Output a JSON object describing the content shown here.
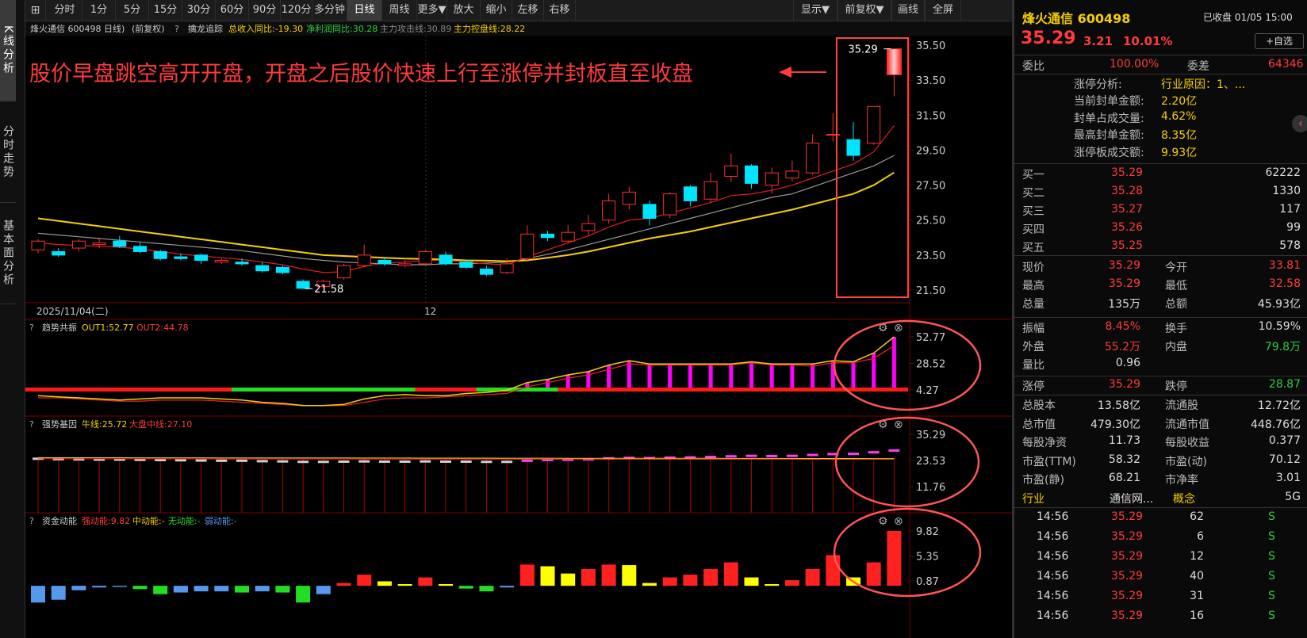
{
  "left_tabs": [
    "K线分析",
    "分时走势",
    "基本面分析"
  ],
  "toolbar": {
    "left": [
      "分时",
      "1分",
      "5分",
      "15分",
      "30分",
      "60分",
      "90分",
      "120分",
      "多分钟",
      "日线",
      "周线",
      "更多▼",
      "放大",
      "缩小",
      "左移",
      "右移"
    ],
    "active": "日线",
    "right": [
      "显示▼",
      "前复权▼",
      "画线",
      "全屏"
    ]
  },
  "main": {
    "header_name": "烽火通信 600498 日线)",
    "header_adj": "(前复权)",
    "indicator_name": "擒龙追踪",
    "indicator_values": [
      {
        "text": "总收入同比:-19.30",
        "color": "#f5d000"
      },
      {
        "text": "净利润同比:30.28",
        "color": "#2ecc40"
      },
      {
        "text": "主力攻击线:30.89",
        "color": "#888888"
      },
      {
        "text": "主力控盘线:28.22",
        "color": "#f5d000"
      }
    ],
    "y_labels": [
      "35.50",
      "33.50",
      "31.50",
      "29.50",
      "27.50",
      "25.50",
      "23.50",
      "21.50"
    ],
    "y_values": [
      35.5,
      33.5,
      31.5,
      29.5,
      27.5,
      25.5,
      23.5,
      21.5
    ],
    "annotation": "股价早盘跳空高开开盘，开盘之后股价快速上行至涨停并封板直至收盘",
    "high_label": "35.29",
    "low_label": "21.58",
    "date_label": "2025/11/04(二)",
    "month_label": "12",
    "candles": [
      {
        "o": 23.8,
        "c": 24.3,
        "h": 24.4,
        "l": 23.6
      },
      {
        "o": 23.7,
        "c": 23.5,
        "h": 23.9,
        "l": 23.4
      },
      {
        "o": 23.9,
        "c": 24.3,
        "h": 24.4,
        "l": 23.7
      },
      {
        "o": 24.1,
        "c": 24.2,
        "h": 24.5,
        "l": 23.9
      },
      {
        "o": 24.3,
        "c": 24.0,
        "h": 24.6,
        "l": 23.9
      },
      {
        "o": 24.0,
        "c": 23.7,
        "h": 24.2,
        "l": 23.6
      },
      {
        "o": 23.7,
        "c": 23.3,
        "h": 23.8,
        "l": 23.2
      },
      {
        "o": 23.4,
        "c": 23.3,
        "h": 23.6,
        "l": 23.2
      },
      {
        "o": 23.5,
        "c": 23.2,
        "h": 23.6,
        "l": 23.0
      },
      {
        "o": 23.1,
        "c": 23.2,
        "h": 23.3,
        "l": 23.0
      },
      {
        "o": 23.1,
        "c": 23.0,
        "h": 23.3,
        "l": 22.9
      },
      {
        "o": 22.9,
        "c": 22.6,
        "h": 23.1,
        "l": 22.5
      },
      {
        "o": 22.8,
        "c": 22.5,
        "h": 22.9,
        "l": 22.4
      },
      {
        "o": 22.0,
        "c": 21.6,
        "h": 22.1,
        "l": 21.58
      },
      {
        "o": 21.7,
        "c": 22.0,
        "h": 22.1,
        "l": 21.6
      },
      {
        "o": 22.2,
        "c": 22.9,
        "h": 23.0,
        "l": 22.1
      },
      {
        "o": 22.9,
        "c": 23.5,
        "h": 24.1,
        "l": 22.8
      },
      {
        "o": 23.2,
        "c": 23.0,
        "h": 23.4,
        "l": 22.9
      },
      {
        "o": 22.9,
        "c": 23.0,
        "h": 23.2,
        "l": 22.8
      },
      {
        "o": 23.0,
        "c": 23.7,
        "h": 23.8,
        "l": 22.9
      },
      {
        "o": 23.5,
        "c": 23.0,
        "h": 23.7,
        "l": 22.9
      },
      {
        "o": 23.1,
        "c": 22.8,
        "h": 23.2,
        "l": 22.7
      },
      {
        "o": 22.7,
        "c": 22.4,
        "h": 22.9,
        "l": 22.3
      },
      {
        "o": 22.5,
        "c": 23.0,
        "h": 23.3,
        "l": 22.4
      },
      {
        "o": 23.3,
        "c": 24.7,
        "h": 25.2,
        "l": 23.2
      },
      {
        "o": 24.7,
        "c": 24.5,
        "h": 24.9,
        "l": 24.3
      },
      {
        "o": 24.3,
        "c": 24.8,
        "h": 25.2,
        "l": 24.2
      },
      {
        "o": 24.9,
        "c": 25.3,
        "h": 25.8,
        "l": 24.6
      },
      {
        "o": 25.5,
        "c": 26.6,
        "h": 27.0,
        "l": 25.3
      },
      {
        "o": 26.4,
        "c": 27.1,
        "h": 27.4,
        "l": 26.1
      },
      {
        "o": 26.4,
        "c": 25.6,
        "h": 26.6,
        "l": 25.2
      },
      {
        "o": 25.8,
        "c": 27.0,
        "h": 27.1,
        "l": 25.6
      },
      {
        "o": 27.4,
        "c": 26.6,
        "h": 27.5,
        "l": 26.3
      },
      {
        "o": 26.7,
        "c": 27.7,
        "h": 28.2,
        "l": 26.5
      },
      {
        "o": 28.0,
        "c": 28.6,
        "h": 29.3,
        "l": 27.7
      },
      {
        "o": 28.6,
        "c": 27.6,
        "h": 28.7,
        "l": 27.3
      },
      {
        "o": 27.5,
        "c": 28.2,
        "h": 28.5,
        "l": 27.0
      },
      {
        "o": 27.9,
        "c": 28.3,
        "h": 28.9,
        "l": 27.7
      },
      {
        "o": 28.2,
        "c": 29.9,
        "h": 30.4,
        "l": 28.1
      },
      {
        "o": 30.4,
        "c": 30.4,
        "h": 31.6,
        "l": 30.0
      },
      {
        "o": 30.1,
        "c": 29.2,
        "h": 31.1,
        "l": 28.9
      },
      {
        "o": 29.9,
        "c": 32.0,
        "h": 32.0,
        "l": 29.8
      },
      {
        "o": 33.81,
        "c": 35.29,
        "h": 35.29,
        "l": 32.58
      }
    ],
    "ma_gray": [
      24.75,
      24.65,
      24.55,
      24.45,
      24.35,
      24.25,
      24.15,
      24.05,
      23.95,
      23.85,
      23.75,
      23.6,
      23.45,
      23.3,
      23.2,
      23.1,
      23.05,
      23.0,
      22.95,
      22.95,
      23.0,
      23.0,
      23.05,
      23.1,
      23.3,
      23.55,
      23.8,
      24.1,
      24.4,
      24.7,
      25.0,
      25.3,
      25.6,
      25.9,
      26.2,
      26.5,
      26.8,
      27.0,
      27.4,
      27.8,
      28.2,
      28.6,
      29.2
    ],
    "ma_red": [
      24.2,
      24.1,
      24.05,
      24.0,
      23.95,
      23.85,
      23.7,
      23.55,
      23.45,
      23.35,
      23.25,
      23.1,
      22.95,
      22.7,
      22.5,
      22.55,
      22.85,
      23.05,
      23.1,
      23.2,
      23.2,
      23.1,
      23.0,
      22.95,
      23.4,
      23.8,
      24.2,
      24.6,
      25.1,
      25.5,
      25.6,
      25.9,
      26.2,
      26.5,
      26.9,
      27.0,
      27.2,
      27.5,
      27.9,
      28.3,
      28.7,
      29.4,
      30.9
    ],
    "ma_yellow": [
      25.6,
      25.45,
      25.3,
      25.15,
      25.0,
      24.85,
      24.7,
      24.55,
      24.4,
      24.25,
      24.1,
      23.95,
      23.8,
      23.65,
      23.5,
      23.45,
      23.4,
      23.35,
      23.3,
      23.28,
      23.25,
      23.2,
      23.18,
      23.15,
      23.2,
      23.35,
      23.5,
      23.7,
      23.95,
      24.2,
      24.45,
      24.65,
      24.85,
      25.1,
      25.35,
      25.6,
      25.85,
      26.1,
      26.4,
      26.7,
      27.0,
      27.5,
      28.22
    ]
  },
  "panel2": {
    "title": "趋势共振",
    "v1": "OUT1:52.77",
    "v2": "OUT2:44.78",
    "y_labels": [
      "52.77",
      "28.52",
      "4.27"
    ],
    "y_values": [
      52.77,
      28.52,
      4.27
    ],
    "out1": [
      -1,
      -2,
      -3,
      -4,
      -5,
      -4,
      -3,
      -3,
      -3,
      -4,
      -5,
      -7,
      -8,
      -10,
      -10,
      -9,
      -4,
      -1,
      0,
      -1,
      -1,
      1,
      2,
      4,
      11,
      14,
      18,
      21,
      27,
      31,
      28,
      28,
      28,
      28,
      28,
      30,
      28,
      28,
      28,
      31,
      30,
      38,
      52.77
    ],
    "out2": [
      -3,
      -3,
      -4,
      -5,
      -6,
      -6,
      -5,
      -5,
      -5,
      -6,
      -7,
      -8,
      -9,
      -10,
      -10,
      -10,
      -7,
      -4,
      -3,
      -3,
      -2,
      -1,
      0,
      1,
      7,
      11,
      15,
      18,
      23,
      28,
      27,
      27,
      27,
      27,
      27,
      29,
      27,
      27,
      26,
      29,
      29,
      33,
      44.78
    ],
    "bar_colors": [
      "red",
      "red",
      "red",
      "red",
      "red",
      "red",
      "red",
      "red",
      "red",
      "red",
      "green",
      "green",
      "green",
      "green",
      "green",
      "green",
      "green",
      "green",
      "green",
      "red",
      "red",
      "red",
      "green",
      "green",
      "green",
      "green",
      "red",
      "red",
      "red",
      "red",
      "red",
      "red",
      "red",
      "red",
      "red",
      "red",
      "red",
      "red",
      "red",
      "red",
      "red",
      "red",
      "red"
    ]
  },
  "panel3": {
    "title": "强势基因",
    "v1": "牛线:25.72",
    "v2": "大盘中线:27.10",
    "y_labels": [
      "35.29",
      "23.53",
      "11.76"
    ],
    "y_values": [
      35.29,
      23.53,
      11.76
    ]
  },
  "panel4": {
    "title": "资金动能",
    "v1": "强动能:9.82",
    "v2": "中动能:-",
    "v3": "无动能:-",
    "v4": "弱动能:-",
    "y_labels": [
      "9.82",
      "5.35",
      "0.87"
    ],
    "y_values": [
      9.82,
      5.35,
      0.87
    ],
    "bars": [
      -3,
      -2.5,
      -0.8,
      -0.3,
      -0.2,
      -0.6,
      -1.5,
      -1.2,
      -1.0,
      -1.0,
      -1.2,
      -1.0,
      -1.2,
      -3.0,
      -1.5,
      0.5,
      2.0,
      0.8,
      0.3,
      1.5,
      0.3,
      -0.5,
      -1.0,
      -0.3,
      3.8,
      3.5,
      2.2,
      3.0,
      3.8,
      3.7,
      0.5,
      1.5,
      2.0,
      3.0,
      4.2,
      1.5,
      0.3,
      1.0,
      3.0,
      5.5,
      1.5,
      4.2,
      9.82
    ],
    "colors": [
      "#5599ee",
      "#5599ee",
      "#5599ee",
      "#5599ee",
      "#5599ee",
      "#22dd22",
      "#22dd22",
      "#5599ee",
      "#5599ee",
      "#5599ee",
      "#22dd22",
      "#5599ee",
      "#22dd22",
      "#22dd22",
      "#5599ee",
      "#ff2020",
      "#ff2020",
      "#ffff00",
      "#ffff00",
      "#ff2020",
      "#ffff00",
      "#22dd22",
      "#22dd22",
      "#5599ee",
      "#ff2020",
      "#ffff00",
      "#ffff00",
      "#ff2020",
      "#ff2020",
      "#ffff00",
      "#ffff00",
      "#ff2020",
      "#ff2020",
      "#ff2020",
      "#ff2020",
      "#ffff00",
      "#ffff00",
      "#ff2020",
      "#ff2020",
      "#ff2020",
      "#ffff00",
      "#ff2020",
      "#ff2020"
    ]
  },
  "info": {
    "title": "烽火通信 600498",
    "status": "已收盘 01/05 15:00",
    "price": "35.29",
    "change": "3.21",
    "pct": "10.01%",
    "fav": "+自选",
    "webi_label": "委比",
    "webi": "100.00%",
    "weicha_label": "委差",
    "weicha": "64346",
    "limit_rows": [
      {
        "label": "涨停分析:",
        "value": "行业原因：1、..."
      },
      {
        "label": "当前封单金额:",
        "value": "2.20亿"
      },
      {
        "label": "封单占成交量:",
        "value": "4.62%"
      },
      {
        "label": "最高封单金额:",
        "value": "8.35亿"
      },
      {
        "label": "涨停板成交额:",
        "value": "9.93亿"
      }
    ],
    "bids": [
      {
        "label": "买一",
        "price": "35.29",
        "vol": "62222"
      },
      {
        "label": "买二",
        "price": "35.28",
        "vol": "1330"
      },
      {
        "label": "买三",
        "price": "35.27",
        "vol": "117"
      },
      {
        "label": "买四",
        "price": "35.26",
        "vol": "99"
      },
      {
        "label": "买五",
        "price": "35.25",
        "vol": "578"
      }
    ],
    "quote1": [
      {
        "l1": "现价",
        "v1": "35.29",
        "c1": "red",
        "l2": "今开",
        "v2": "33.81",
        "c2": "red"
      },
      {
        "l1": "最高",
        "v1": "35.29",
        "c1": "red",
        "l2": "最低",
        "v2": "32.58",
        "c2": "red"
      },
      {
        "l1": "总量",
        "v1": "135万",
        "c1": "white",
        "l2": "总额",
        "v2": "45.93亿",
        "c2": "white"
      }
    ],
    "quote2": [
      {
        "l1": "振幅",
        "v1": "8.45%",
        "c1": "red",
        "l2": "换手",
        "v2": "10.59%",
        "c2": "white"
      },
      {
        "l1": "外盘",
        "v1": "55.2万",
        "c1": "red",
        "l2": "内盘",
        "v2": "79.8万",
        "c2": "green"
      },
      {
        "l1": "量比",
        "v1": "0.96",
        "c1": "white",
        "l2": "",
        "v2": "",
        "c2": "white"
      }
    ],
    "quote3": [
      {
        "l1": "涨停",
        "v1": "35.29",
        "c1": "red",
        "l2": "跌停",
        "v2": "28.87",
        "c2": "green"
      }
    ],
    "fund": [
      {
        "l1": "总股本",
        "v1": "13.58亿",
        "l2": "流通股",
        "v2": "12.72亿"
      },
      {
        "l1": "总市值",
        "v1": "479.30亿",
        "l2": "流通市值",
        "v2": "448.76亿"
      },
      {
        "l1": "每股净资",
        "v1": "11.73",
        "l2": "每股收益",
        "v2": "0.377"
      },
      {
        "l1": "市盈(TTM)",
        "v1": "58.32",
        "l2": "市盈(动)",
        "v2": "70.12"
      },
      {
        "l1": "市盈(静)",
        "v1": "68.21",
        "l2": "市净率",
        "v2": "3.01"
      }
    ],
    "industry_label": "行业",
    "industry": "通信网...",
    "concept_label": "概念",
    "concept": "5G",
    "ticks": [
      {
        "time": "14:56",
        "price": "35.29",
        "vol": "62",
        "side": "S"
      },
      {
        "time": "14:56",
        "price": "35.29",
        "vol": "6",
        "side": "S"
      },
      {
        "time": "14:56",
        "price": "35.29",
        "vol": "12",
        "side": "S"
      },
      {
        "time": "14:56",
        "price": "35.29",
        "vol": "40",
        "side": "S"
      },
      {
        "time": "14:56",
        "price": "35.29",
        "vol": "31",
        "side": "S"
      },
      {
        "time": "14:56",
        "price": "35.29",
        "vol": "16",
        "side": "S"
      }
    ]
  }
}
